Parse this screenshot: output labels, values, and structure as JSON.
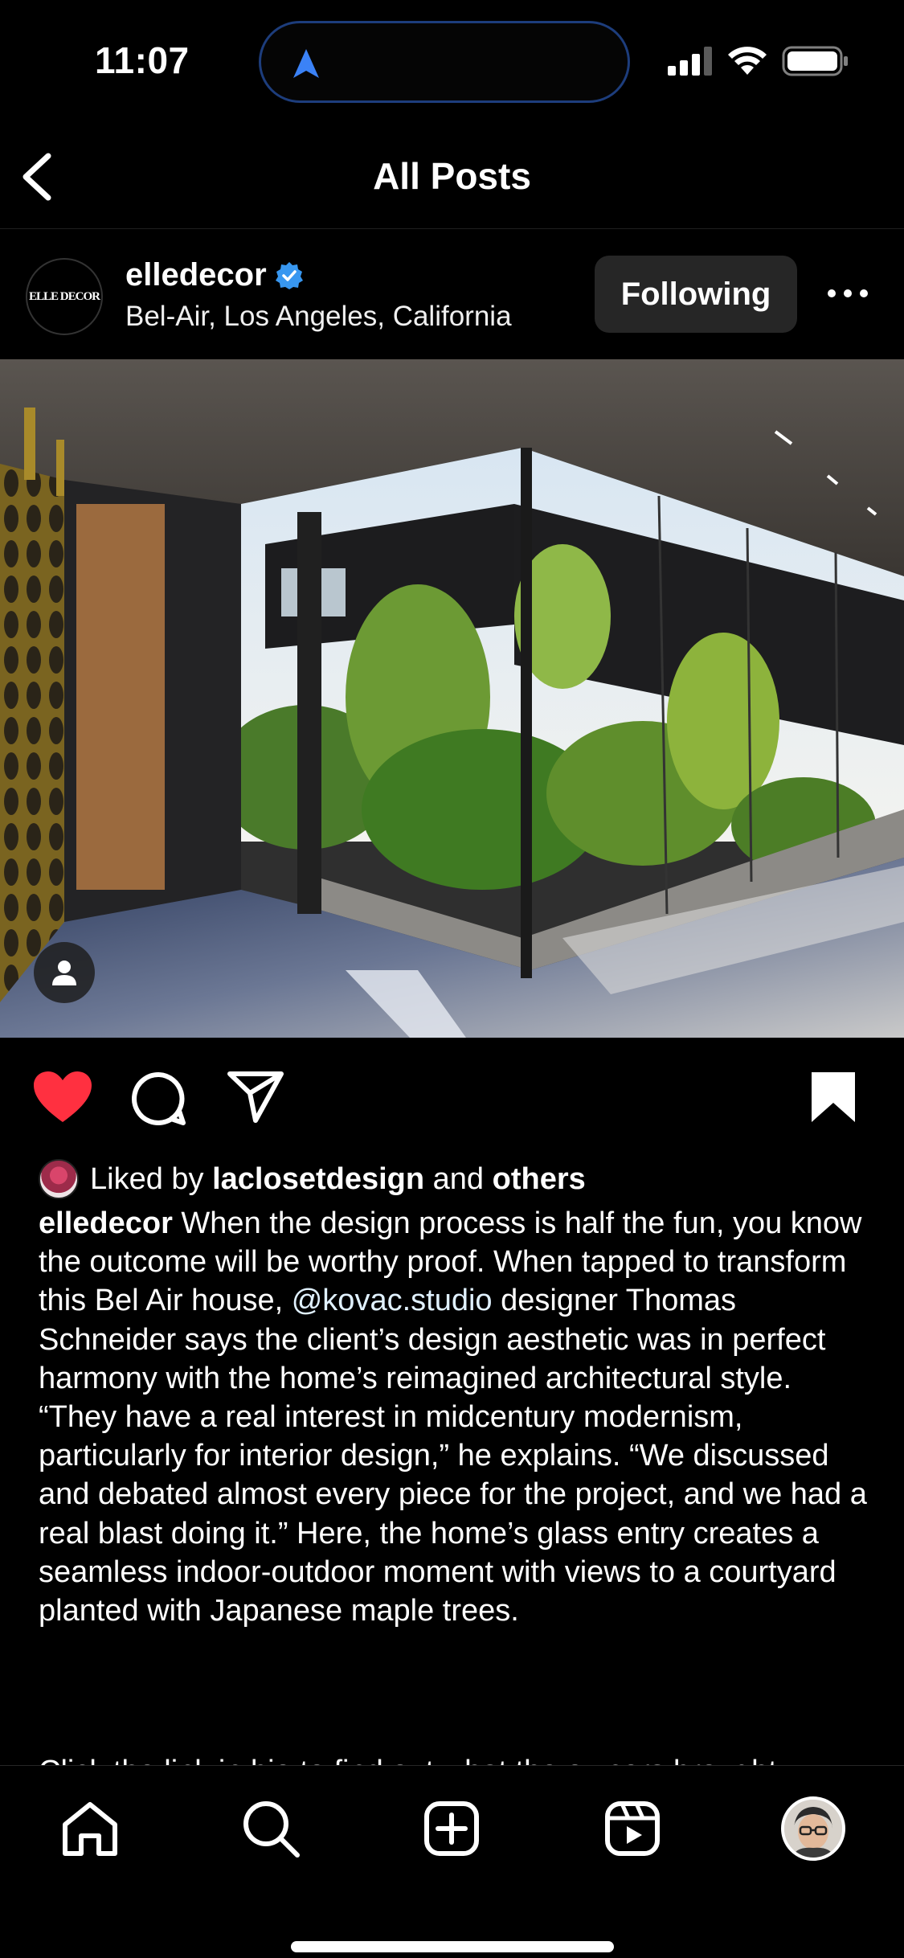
{
  "status_bar": {
    "time": "11:07",
    "icons": [
      "location-arrow-icon",
      "cellular-signal-icon",
      "wifi-icon",
      "battery-icon"
    ]
  },
  "header": {
    "title": "All Posts",
    "back_icon": "chevron-left-icon"
  },
  "post": {
    "username": "elledecor",
    "verified": true,
    "location": "Bel-Air, Los Angeles, California",
    "follow_label": "Following",
    "avatar_text": "ELLE DECOR",
    "liked": true,
    "saved": true,
    "likes": {
      "prefix": "Liked by",
      "user": "laclosetdesign",
      "conjunction": "and",
      "others": "others"
    },
    "caption": {
      "user": "elledecor",
      "part1": " When the design process is half the fun, you know the outcome will be worthy proof. When tapped to transform this Bel Air house, ",
      "mention": "@kovac.studio",
      "part2": " designer Thomas Schneider says the client’s design aesthetic was in perfect harmony with the home’s reimagined architectural style. “They have a real interest in midcentury modernism, particularly for interior design,” he explains. “We discussed and debated almost every piece for the project, and we had a real blast doing it.” Here, the home’s glass entry creates a seamless indoor-outdoor moment with views to a courtyard planted with Japanese maple trees.",
      "next_line": "Click the link in bio to find out what the owners brought"
    }
  },
  "bottom_nav": {
    "items": [
      "home-icon",
      "search-icon",
      "create-icon",
      "reels-icon",
      "profile-avatar"
    ]
  },
  "colors": {
    "background": "#000000",
    "like_red": "#ff3040",
    "follow_button_bg": "#262626",
    "verified_blue": "#3897f0",
    "island_border": "#1d3d7c"
  }
}
